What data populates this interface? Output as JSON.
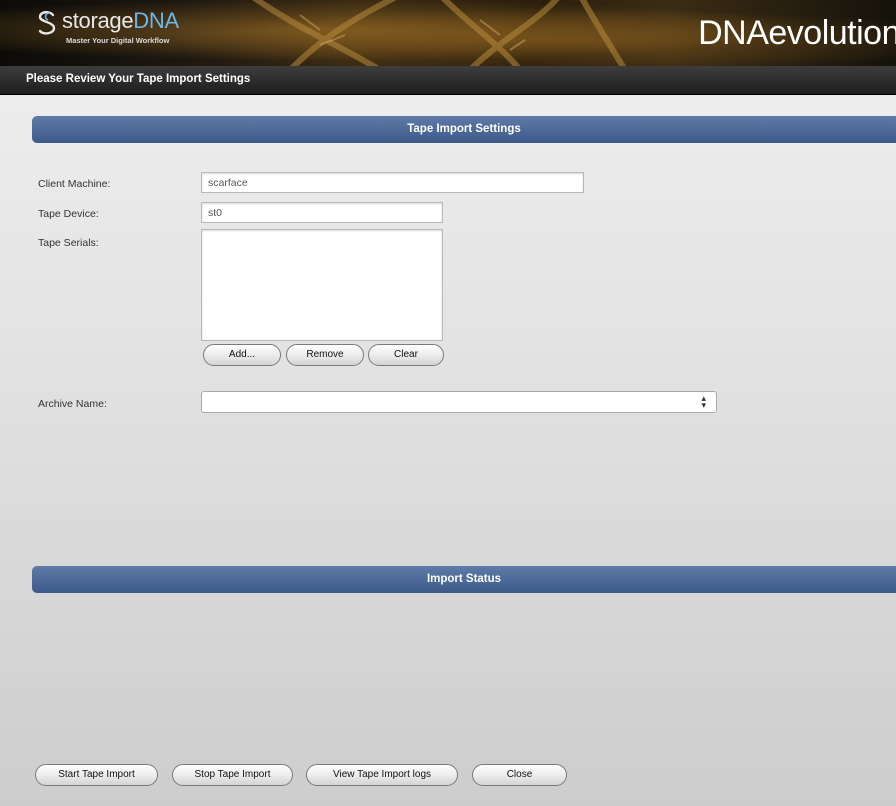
{
  "brand": {
    "logo_name": "storage",
    "logo_name_accent": "DNA",
    "tagline": "Master Your Digital Workflow",
    "product": "DNAevolution",
    "accent_color": "#6fb6e8"
  },
  "page_title": "Please Review Your Tape Import Settings",
  "settings_section": {
    "header": "Tape Import Settings",
    "client_machine": {
      "label": "Client Machine:",
      "value": "scarface"
    },
    "tape_device": {
      "label": "Tape Device:",
      "value": "st0"
    },
    "tape_serials": {
      "label": "Tape Serials:",
      "items": []
    },
    "serial_buttons": {
      "add": "Add...",
      "remove": "Remove",
      "clear": "Clear"
    },
    "archive_name": {
      "label": "Archive Name:",
      "value": ""
    }
  },
  "status_section": {
    "header": "Import Status"
  },
  "footer_buttons": {
    "start": "Start Tape Import",
    "stop": "Stop Tape Import",
    "logs": "View Tape Import logs",
    "close": "Close"
  },
  "colors": {
    "section_header": "#4a6594",
    "title_bar": "#2a2a2a"
  }
}
